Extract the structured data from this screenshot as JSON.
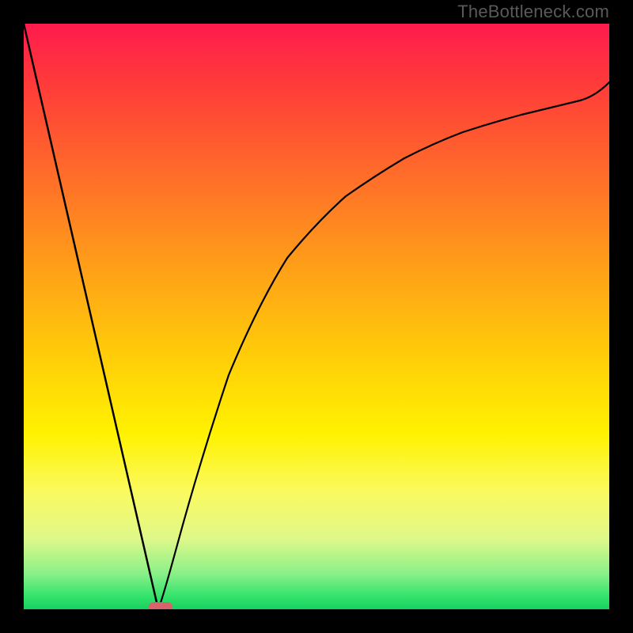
{
  "watermark": "TheBottleneck.com",
  "chart_data": {
    "type": "line",
    "title": "",
    "xlabel": "",
    "ylabel": "",
    "xlim": [
      0,
      100
    ],
    "ylim": [
      0,
      100
    ],
    "grid": false,
    "legend": false,
    "series": [
      {
        "name": "left-slope",
        "x": [
          0,
          23
        ],
        "y": [
          100,
          0
        ]
      },
      {
        "name": "right-curve",
        "x": [
          23,
          26,
          30,
          35,
          40,
          45,
          50,
          55,
          60,
          65,
          70,
          75,
          80,
          85,
          90,
          95,
          100
        ],
        "y": [
          0,
          10,
          25,
          40,
          52,
          61,
          68,
          73,
          77,
          80.5,
          83,
          85,
          86.5,
          87.8,
          88.8,
          89.5,
          90
        ]
      }
    ],
    "marker": {
      "name": "min-point",
      "x": 23,
      "y": 0,
      "color": "#d9636a",
      "shape": "pill"
    },
    "background_gradient": {
      "top_color": "#ff1b4d",
      "bottom_color": "#18d060"
    }
  }
}
